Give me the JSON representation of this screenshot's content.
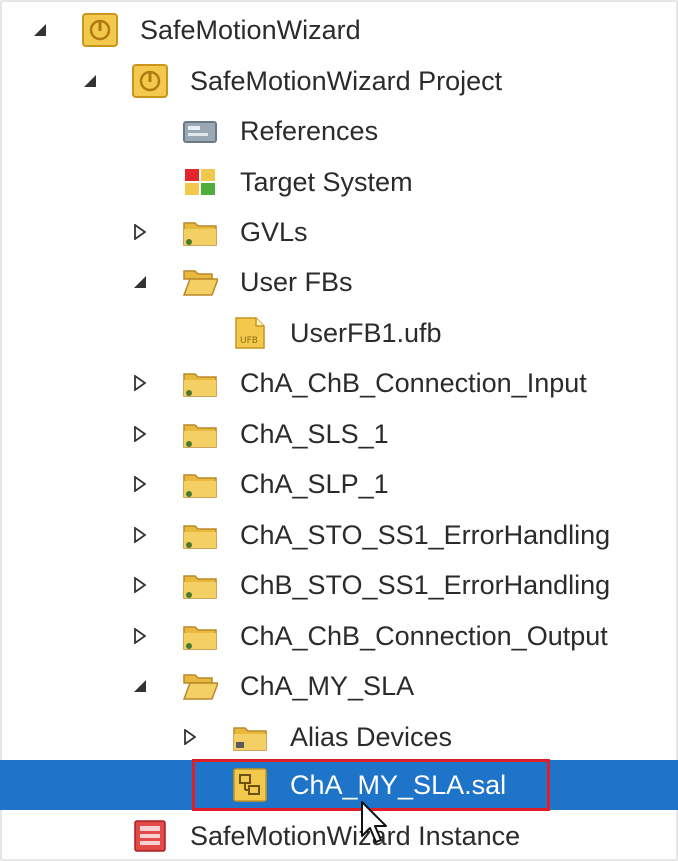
{
  "tree": {
    "nodes": [
      {
        "label": "SafeMotionWizard",
        "expander": "expanded",
        "icon": "safety-project-icon"
      },
      {
        "label": "SafeMotionWizard Project",
        "expander": "expanded",
        "icon": "safety-project-icon"
      },
      {
        "label": "References",
        "expander": "none",
        "icon": "references-icon"
      },
      {
        "label": "Target System",
        "expander": "none",
        "icon": "target-system-icon"
      },
      {
        "label": "GVLs",
        "expander": "collapsed",
        "icon": "folder-icon"
      },
      {
        "label": "User FBs",
        "expander": "expanded",
        "icon": "folder-open-icon"
      },
      {
        "label": "UserFB1.ufb",
        "expander": "none",
        "icon": "ufb-file-icon"
      },
      {
        "label": "ChA_ChB_Connection_Input",
        "expander": "collapsed",
        "icon": "folder-icon"
      },
      {
        "label": "ChA_SLS_1",
        "expander": "collapsed",
        "icon": "folder-icon"
      },
      {
        "label": "ChA_SLP_1",
        "expander": "collapsed",
        "icon": "folder-icon"
      },
      {
        "label": "ChA_STO_SS1_ErrorHandling",
        "expander": "collapsed",
        "icon": "folder-icon"
      },
      {
        "label": "ChB_STO_SS1_ErrorHandling",
        "expander": "collapsed",
        "icon": "folder-icon"
      },
      {
        "label": "ChA_ChB_Connection_Output",
        "expander": "collapsed",
        "icon": "folder-icon"
      },
      {
        "label": "ChA_MY_SLA",
        "expander": "expanded",
        "icon": "folder-open-icon"
      },
      {
        "label": "Alias Devices",
        "expander": "collapsed",
        "icon": "folder-icon"
      },
      {
        "label": "ChA_MY_SLA.sal",
        "expander": "none",
        "icon": "sal-file-icon",
        "selected": true
      },
      {
        "label": "SafeMotionWizard Instance",
        "expander": "none",
        "icon": "instance-icon"
      }
    ]
  },
  "colors": {
    "selection": "#1e74c8",
    "highlight_border": "#e01e27",
    "folder": "#e8b93c"
  }
}
